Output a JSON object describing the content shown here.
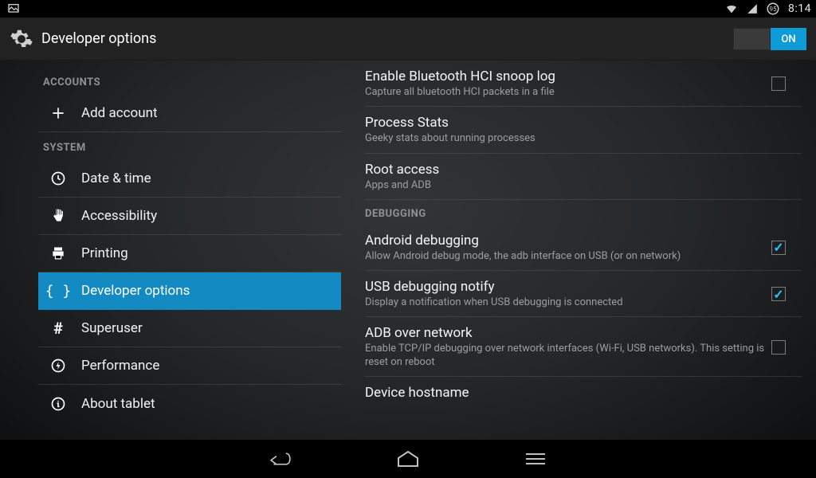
{
  "status_bar": {
    "clock": "8:14",
    "battery_pct": "95"
  },
  "action_bar": {
    "title": "Developer options",
    "toggle": {
      "state": "on",
      "on_label": "ON"
    }
  },
  "sidebar": {
    "categories": [
      {
        "label": "ACCOUNTS",
        "items": [
          {
            "id": "add-account",
            "label": "Add account",
            "icon": "plus-icon",
            "selected": false
          }
        ]
      },
      {
        "label": "SYSTEM",
        "items": [
          {
            "id": "date-time",
            "label": "Date & time",
            "icon": "clock-icon",
            "selected": false
          },
          {
            "id": "accessibility",
            "label": "Accessibility",
            "icon": "hand-icon",
            "selected": false
          },
          {
            "id": "printing",
            "label": "Printing",
            "icon": "printer-icon",
            "selected": false
          },
          {
            "id": "dev-options",
            "label": "Developer options",
            "icon": "braces-icon",
            "selected": true
          },
          {
            "id": "superuser",
            "label": "Superuser",
            "icon": "hash-icon",
            "selected": false
          },
          {
            "id": "performance",
            "label": "Performance",
            "icon": "bolt-icon",
            "selected": false
          },
          {
            "id": "about",
            "label": "About tablet",
            "icon": "info-icon",
            "selected": false
          }
        ]
      }
    ]
  },
  "settings": {
    "items": [
      {
        "title": "Enable Bluetooth HCI snoop log",
        "sub": "Capture all bluetooth HCI packets in a file",
        "checkbox": true,
        "checked": false
      },
      {
        "title": "Process Stats",
        "sub": "Geeky stats about running processes"
      },
      {
        "title": "Root access",
        "sub": "Apps and ADB"
      }
    ],
    "section_header": "DEBUGGING",
    "debug_items": [
      {
        "title": "Android debugging",
        "sub": "Allow Android debug mode, the adb interface on USB (or on network)",
        "checkbox": true,
        "checked": true
      },
      {
        "title": "USB debugging notify",
        "sub": "Display a notification when USB debugging is connected",
        "checkbox": true,
        "checked": true
      },
      {
        "title": "ADB over network",
        "sub": "Enable TCP/IP debugging over network interfaces (Wi-Fi, USB networks). This setting is reset on reboot",
        "checkbox": true,
        "checked": false
      },
      {
        "title": "Device hostname",
        "sub": ""
      }
    ]
  }
}
